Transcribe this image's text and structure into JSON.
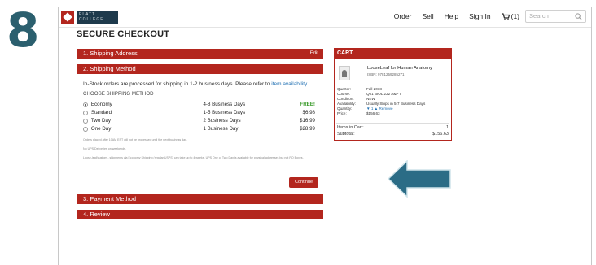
{
  "step_number": "8",
  "header": {
    "logo_line1": "PLATT",
    "logo_line2": "COLLEGE",
    "nav": [
      "Order",
      "Sell",
      "Help",
      "Sign In"
    ],
    "cart_count": "(1)",
    "search_placeholder": "Search"
  },
  "checkout": {
    "title": "SECURE CHECKOUT",
    "steps": [
      {
        "label": "1. Shipping Address",
        "action": "Edit"
      },
      {
        "label": "2. Shipping Method"
      },
      {
        "label": "3. Payment Method"
      },
      {
        "label": "4. Review"
      }
    ],
    "note_prefix": "In-Stock orders are processed for shipping in 1-2 business days. Please refer to ",
    "note_link": "item availability",
    "note_suffix": ".",
    "choose_label": "CHOOSE SHIPPING METHOD",
    "methods": [
      {
        "name": "Economy",
        "days": "4-8 Business Days",
        "price": "FREE!",
        "selected": true
      },
      {
        "name": "Standard",
        "days": "1-5 Business Days",
        "price": "$6.98",
        "selected": false
      },
      {
        "name": "Two Day",
        "days": "2 Business Days",
        "price": "$16.99",
        "selected": false
      },
      {
        "name": "One Day",
        "days": "1 Business Day",
        "price": "$28.99",
        "selected": false
      }
    ],
    "fine_print": [
      "Orders placed after 10AM EST will not be processed until the next business day.",
      "No UPS Deliveries on weekends.",
      "Loose-leaf/custom - shipments via Economy Shipping (regular USPS) can take up to 4 weeks. UPS One or Two Day is available for physical addresses but not PO Boxes."
    ],
    "continue_label": "Continue"
  },
  "cart": {
    "title": "CART",
    "item_title": "LooseLeaf for Human Anatomy",
    "isbn": "ISBN: 9781259285271",
    "details": [
      {
        "k": "Quarter:",
        "v": "Fall 2018"
      },
      {
        "k": "Course:",
        "v": "Q01 BIOL 222 A&P I"
      },
      {
        "k": "Condition:",
        "v": "NEW"
      },
      {
        "k": "Availability:",
        "v": "Usually Ships in 5-7 Business Days"
      },
      {
        "k": "Quantity:",
        "v": "▼ 1 ▲  Remove"
      },
      {
        "k": "Price:",
        "v": "$156.63"
      }
    ],
    "items_label": "Items in Cart:",
    "items_value": "1",
    "subtotal_label": "Subtotal:",
    "subtotal_value": "$156.63"
  },
  "colors": {
    "brand_red": "#b3261e",
    "arrow": "#2b6c86",
    "step_badge": "#2b5f6e"
  }
}
